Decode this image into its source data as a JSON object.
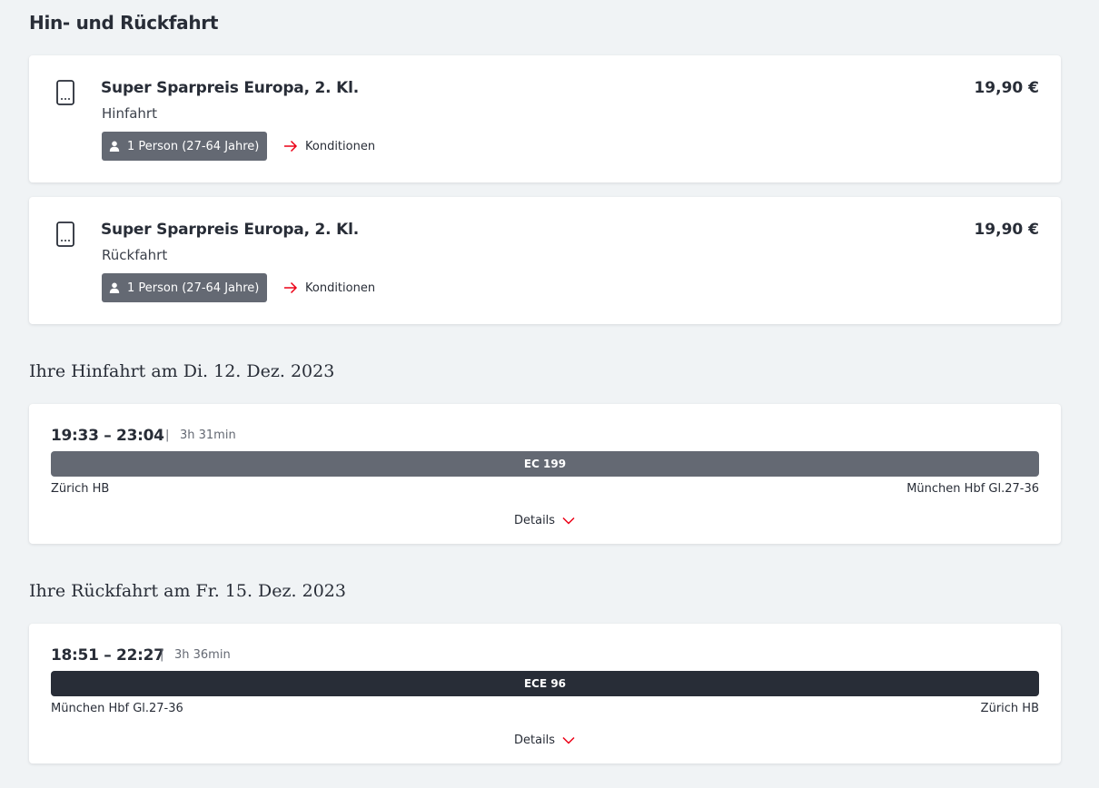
{
  "heading": "Hin- und Rückfahrt",
  "fares": [
    {
      "title": "Super Sparpreis Europa, 2. Kl.",
      "direction": "Hinfahrt",
      "price": "19,90 €",
      "person": "1 Person (27-64 Jahre)",
      "conditions_link": "Konditionen"
    },
    {
      "title": "Super Sparpreis Europa, 2. Kl.",
      "direction": "Rückfahrt",
      "price": "19,90 €",
      "person": "1 Person (27-64 Jahre)",
      "conditions_link": "Konditionen"
    }
  ],
  "outbound": {
    "heading": "Ihre Hinfahrt am Di. 12. Dez. 2023",
    "times": "19:33 – 23:04",
    "separator": "|",
    "duration": "3h 31min",
    "train": "EC 199",
    "train_color": "#646973",
    "from": "Zürich HB",
    "to": "München Hbf Gl.27-36",
    "details_label": "Details"
  },
  "return": {
    "heading": "Ihre Rückfahrt am Fr. 15. Dez. 2023",
    "times": "18:51 – 22:27",
    "separator": "|",
    "duration": "3h 36min",
    "train": "ECE 96",
    "train_color": "#282d37",
    "from": "München Hbf Gl.27-36",
    "to": "Zürich HB",
    "details_label": "Details"
  },
  "colors": {
    "accent": "#ec0016",
    "background": "#f0f3f5",
    "badge": "#646973"
  }
}
